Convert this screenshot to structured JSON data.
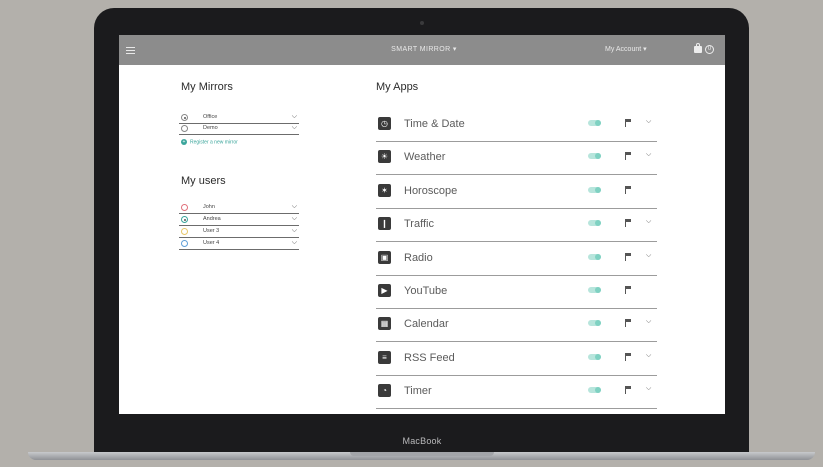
{
  "topbar": {
    "brand": "SMART MIRROR ▾",
    "account": "My Account ▾",
    "cart_count": "0"
  },
  "mirrors": {
    "title": "My Mirrors",
    "items": [
      {
        "label": "Office",
        "selected": true
      },
      {
        "label": "Demo",
        "selected": false
      }
    ],
    "register_label": "Register a new mirror"
  },
  "users": {
    "title": "My users",
    "items": [
      {
        "label": "John",
        "color": "#e0707a",
        "selected": false
      },
      {
        "label": "Andrea",
        "color": "#3aa59b",
        "selected": true
      },
      {
        "label": "User 3",
        "color": "#e7c76a",
        "selected": false
      },
      {
        "label": "User 4",
        "color": "#5f9fd8",
        "selected": false
      }
    ]
  },
  "apps": {
    "title": "My Apps",
    "items": [
      {
        "name": "Time & Date",
        "icon": "clock-icon",
        "glyph": "◷",
        "caret": true
      },
      {
        "name": "Weather",
        "icon": "sun-icon",
        "glyph": "☀",
        "caret": true
      },
      {
        "name": "Horoscope",
        "icon": "star-icon",
        "glyph": "✶",
        "caret": false
      },
      {
        "name": "Traffic",
        "icon": "traffic-light-icon",
        "glyph": "❙",
        "caret": true
      },
      {
        "name": "Radio",
        "icon": "radio-icon",
        "glyph": "▣",
        "caret": true
      },
      {
        "name": "YouTube",
        "icon": "video-icon",
        "glyph": "▶",
        "caret": false
      },
      {
        "name": "Calendar",
        "icon": "calendar-icon",
        "glyph": "▦",
        "caret": true
      },
      {
        "name": "RSS Feed",
        "icon": "rss-icon",
        "glyph": "≡",
        "caret": true
      },
      {
        "name": "Timer",
        "icon": "timer-icon",
        "glyph": "◔",
        "caret": true
      }
    ]
  },
  "device": {
    "label": "MacBook"
  },
  "colors": {
    "accent": "#3aa59b",
    "toggle_on": "#b7e5dc",
    "topbar": "#8c8c8c"
  }
}
